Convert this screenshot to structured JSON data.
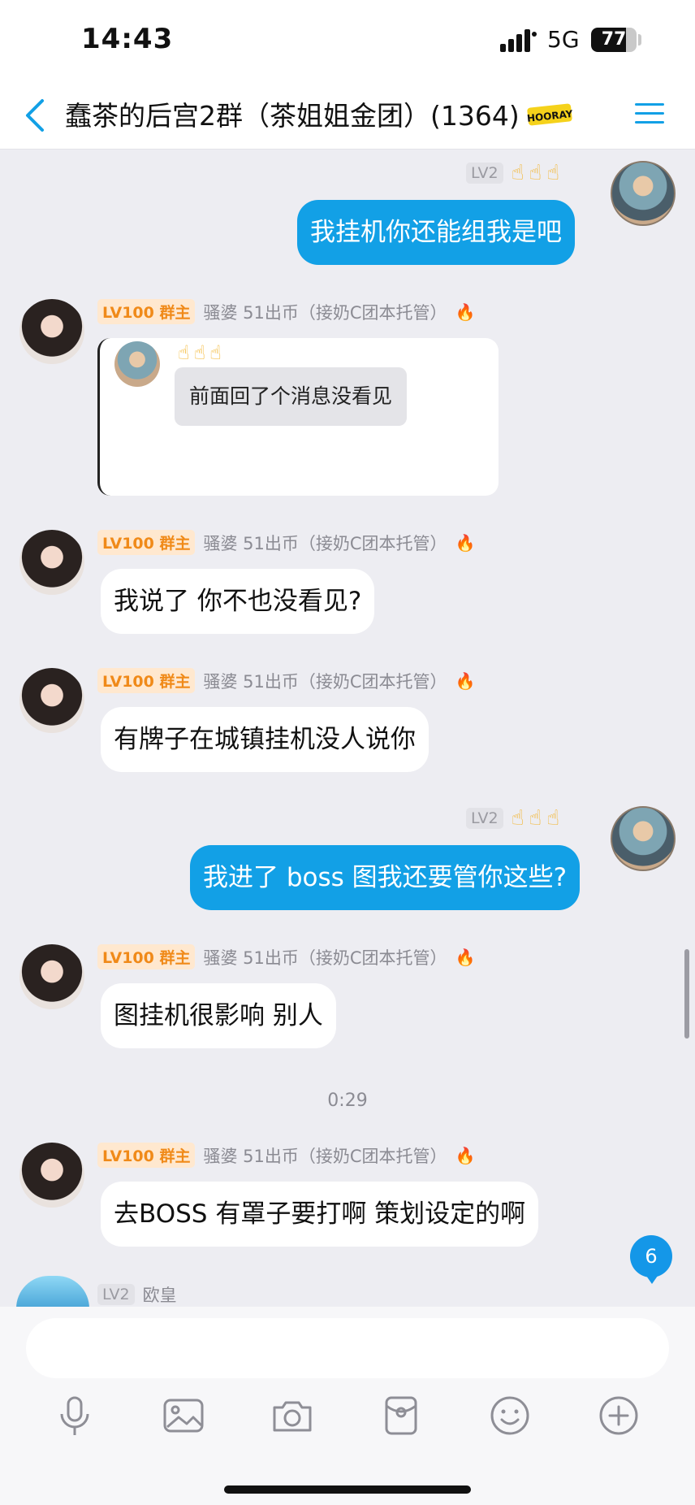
{
  "status_bar": {
    "time": "14:43",
    "network": "5G",
    "battery_percent": 77,
    "battery_text": "77"
  },
  "header": {
    "title": "蠢茶的后宫2群（茶姐姐金团）(1364)",
    "sticker_text": "HOORAY"
  },
  "colors": {
    "accent": "#12a0e6",
    "level_badge": "#f08a19",
    "fire": "#ef5a38"
  },
  "self_user": {
    "level": "LV2",
    "emoji": "☝☝☝"
  },
  "other_user": {
    "level": "LV100 群主",
    "name": "骚婆 51出币（接奶C团本托管）"
  },
  "messages": {
    "m1": {
      "text": "我挂机你还能组我是吧"
    },
    "m2": {
      "quote_emoji": "☝☝☝",
      "quote_text": "前面回了个消息没看见"
    },
    "m3": {
      "text": "我说了 你不也没看见?"
    },
    "m4": {
      "text": "有牌子在城镇挂机没人说你"
    },
    "m5": {
      "text": "我进了 boss 图我还要管你这些?"
    },
    "m6": {
      "text": "图挂机很影响 别人"
    },
    "timestamp": "0:29",
    "m7": {
      "text": "去BOSS 有罩子要打啊 策划设定的啊"
    },
    "m8": {
      "level": "LV2",
      "name": "欧皇"
    }
  },
  "unread_count": "6",
  "input": {
    "placeholder": "",
    "value": ""
  },
  "toolbar_icons": [
    "microphone-icon",
    "image-icon",
    "camera-icon",
    "red-packet-icon",
    "emoji-icon",
    "plus-icon"
  ]
}
